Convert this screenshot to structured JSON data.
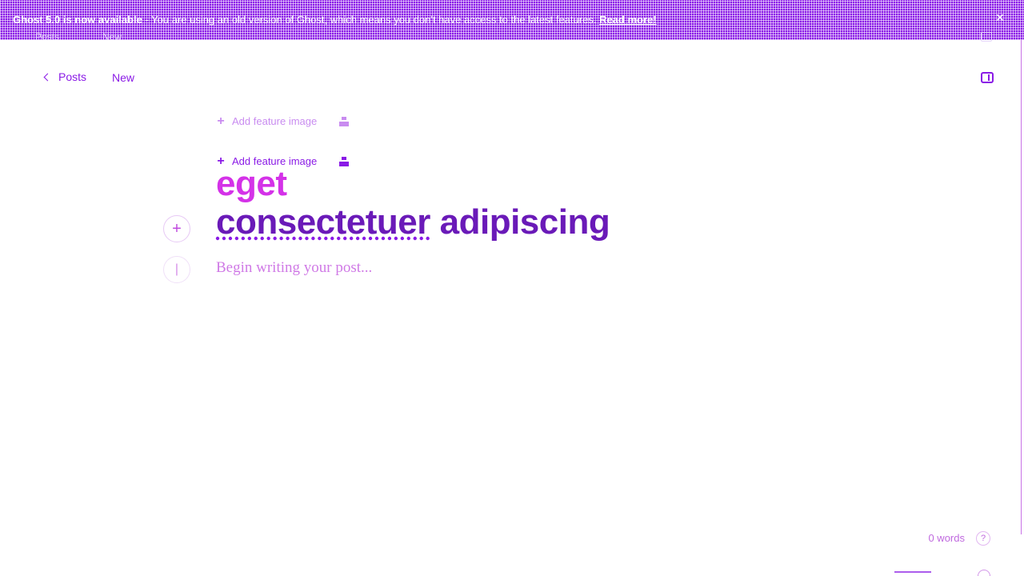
{
  "banner": {
    "title": "Ghost 5.0 is now available",
    "separator": " - ",
    "message": "You are using an old version of Ghost, which means you don't have access to the latest features.",
    "link_label": "Read more!",
    "close_icon": "close-icon"
  },
  "header": {
    "back_label": "Posts",
    "status": "New",
    "settings_icon": "sidebar-toggle-icon"
  },
  "editor": {
    "feature_image_label": "Add feature image",
    "title_line1": "eget",
    "title_line2_underlined": "consectetuer",
    "title_line2_rest": " adipiscing",
    "body_placeholder": "Begin writing your post...",
    "plus_label": "+"
  },
  "footer": {
    "word_count": "0 words",
    "help_label": "?"
  },
  "colors": {
    "accent": "#8a1ae6",
    "title_pink": "#d432e8",
    "title_purple": "#6a1ab8"
  }
}
